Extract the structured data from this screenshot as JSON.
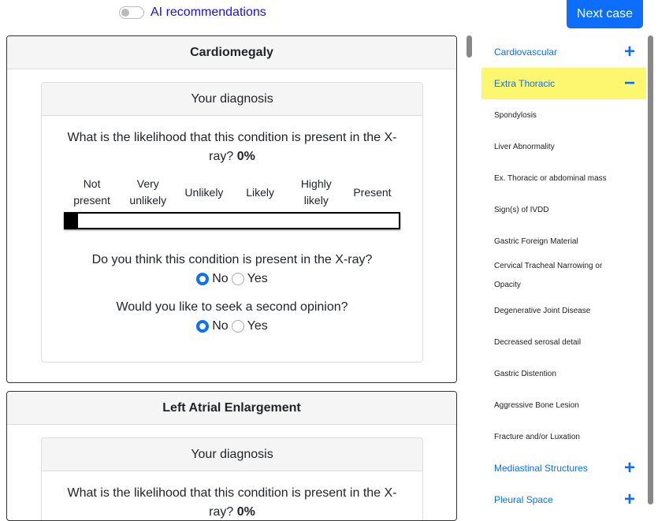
{
  "header": {
    "ai_toggle_label": "AI recommendations",
    "ai_toggle_on": false,
    "next_label": "Next case"
  },
  "cards": [
    {
      "title": "Cardiomegaly",
      "diagnosis_title": "Your diagnosis",
      "likelihood_question": "What is the likelihood that this condition is present in the X-ray?",
      "likelihood_value": "0%",
      "scale": [
        "Not present",
        "Very unlikely",
        "Unlikely",
        "Likely",
        "Highly likely",
        "Present"
      ],
      "present_question": "Do you think this condition is present in the X-ray?",
      "present_answer": "No",
      "second_opinion_question": "Would you like to seek a second opinion?",
      "second_opinion_answer": "No",
      "options": [
        "No",
        "Yes"
      ]
    },
    {
      "title": "Left Atrial Enlargement",
      "diagnosis_title": "Your diagnosis",
      "likelihood_question": "What is the likelihood that this condition is present in the X-ray?",
      "likelihood_value": "0%"
    }
  ],
  "sidebar": {
    "categories": [
      {
        "label": "Cardiovascular",
        "expanded": false,
        "icon": "plus-icon",
        "symbol": "+"
      },
      {
        "label": "Extra Thoracic",
        "expanded": true,
        "icon": "minus-icon",
        "symbol": "−",
        "highlight": "#fdf76f",
        "items": [
          "Spondylosis",
          "Liver Abnormality",
          "Ex. Thoracic or abdominal mass",
          "Sign(s) of IVDD",
          "Gastric Foreign Material",
          "Cervical Tracheal Narrowing or Opacity",
          "Degenerative Joint Disease",
          "Decreased serosal detail",
          "Gastric Distention",
          "Aggressive Bone Lesion",
          "Fracture and/or Luxation"
        ]
      },
      {
        "label": "Mediastinal Structures",
        "expanded": false,
        "icon": "plus-icon",
        "symbol": "+"
      },
      {
        "label": "Pleural Space",
        "expanded": false,
        "icon": "plus-icon",
        "symbol": "+"
      }
    ]
  },
  "colors": {
    "accent": "#0d6efd",
    "highlight": "#fdf76f",
    "link": "#1a0dff"
  }
}
